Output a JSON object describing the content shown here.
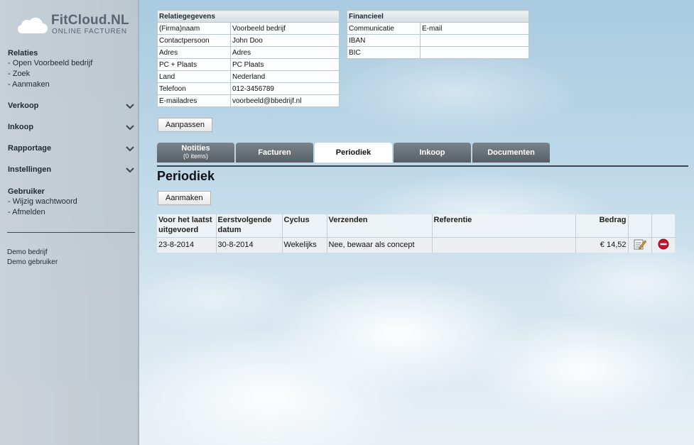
{
  "brand": {
    "name": "FitCloud.NL",
    "tagline": "ONLINE FACTUREN"
  },
  "sidebar": {
    "relaties": {
      "heading": "Relaties",
      "links": [
        "- Open Voorbeeld bedrijf",
        "- Zoek",
        "- Aanmaken"
      ]
    },
    "collapsibles": [
      "Verkoop",
      "Inkoop",
      "Rapportage",
      "Instellingen"
    ],
    "gebruiker": {
      "heading": "Gebruiker",
      "links": [
        "- Wijzig wachtwoord",
        "- Afmelden"
      ]
    },
    "account": {
      "company": "Demo bedrijf",
      "user": "Demo gebruiker"
    }
  },
  "relation": {
    "title": "Relatiegegevens",
    "rows": [
      {
        "label": "(Firma)naam",
        "value": "Voorbeeld bedrijf"
      },
      {
        "label": "Contactpersoon",
        "value": "John Doo"
      },
      {
        "label": "Adres",
        "value": "Adres"
      },
      {
        "label": "PC + Plaats",
        "value": "PC  Plaats"
      },
      {
        "label": "Land",
        "value": "Nederland"
      },
      {
        "label": "Telefoon",
        "value": "012-3456789"
      },
      {
        "label": "E-mailadres",
        "value": "voorbeeld@bbedrijf.nl"
      }
    ]
  },
  "financial": {
    "title": "Financieel",
    "rows": [
      {
        "label": "Communicatie",
        "value": "E-mail"
      },
      {
        "label": "IBAN",
        "value": ""
      },
      {
        "label": "BIC",
        "value": ""
      }
    ]
  },
  "edit_button": "Aanpassen",
  "tabs": [
    {
      "label": "Notities",
      "sub": "(0 items)"
    },
    {
      "label": "Facturen"
    },
    {
      "label": "Periodiek"
    },
    {
      "label": "Inkoop"
    },
    {
      "label": "Documenten"
    }
  ],
  "periodiek": {
    "title": "Periodiek",
    "create_button": "Aanmaken",
    "headers": [
      "Voor het laatst uitgevoerd",
      "Eerstvolgende datum",
      "Cyclus",
      "Verzenden",
      "Referentie",
      "Bedrag"
    ],
    "rows": [
      {
        "last": "23-8-2014",
        "next": "30-8-2014",
        "cycle": "Wekelijks",
        "send": "Nee, bewaar als concept",
        "reference": "",
        "amount": "€ 14,52"
      }
    ]
  },
  "colors": {
    "tab_inactive": "#5f686e",
    "tab_active": "#ffffff",
    "delete_icon": "#c8102e"
  }
}
